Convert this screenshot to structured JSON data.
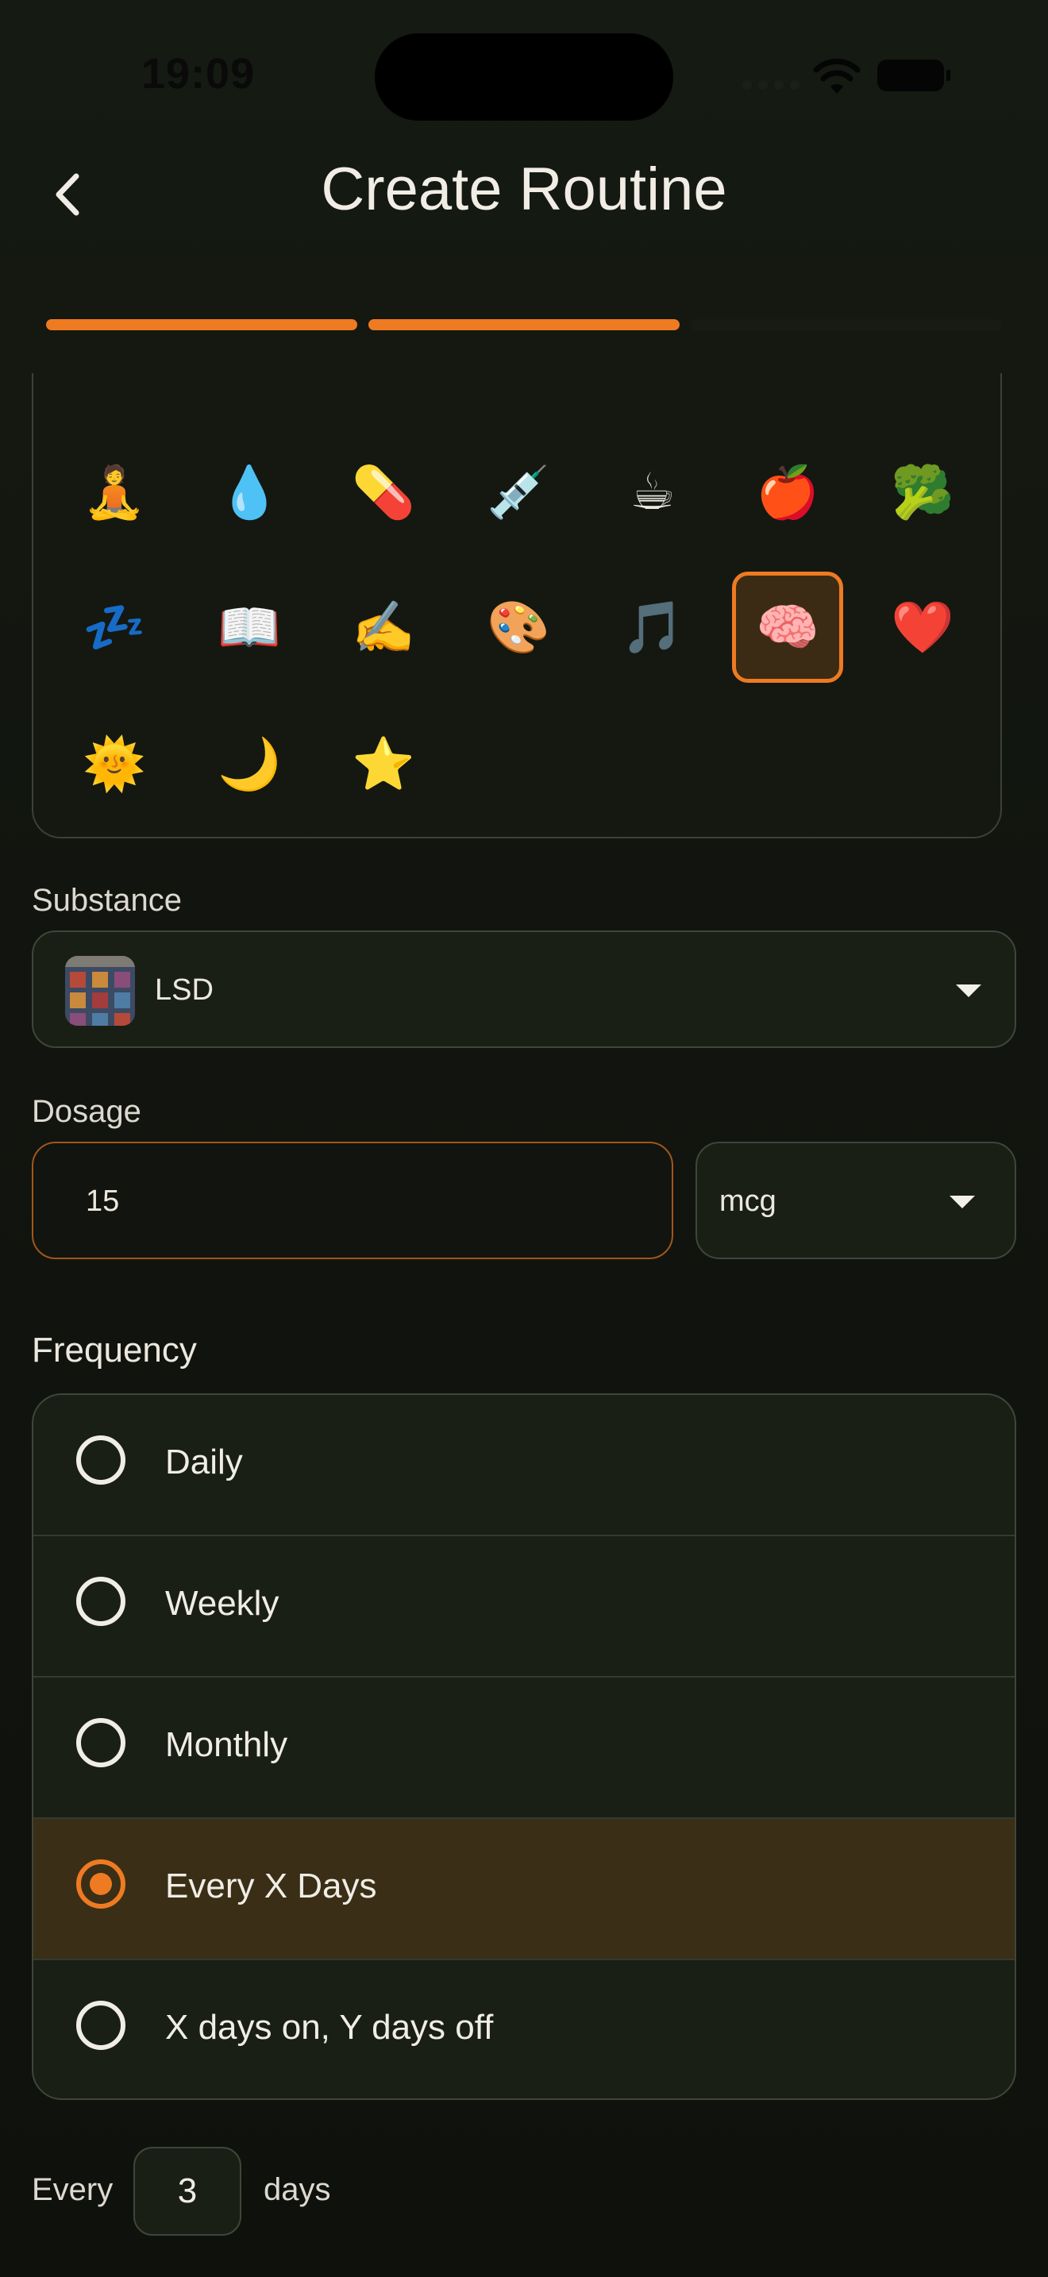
{
  "status_bar": {
    "time": "19:09"
  },
  "header": {
    "title": "Create Routine"
  },
  "progress": {
    "total_steps": 3,
    "completed_steps": 2,
    "accent": "#ee7a22"
  },
  "icon_picker": {
    "icons": [
      "🧘",
      "💧",
      "💊",
      "💉",
      "☕",
      "🍎",
      "🥦",
      "💤",
      "📖",
      "✍️",
      "🎨",
      "🎵",
      "🧠",
      "❤️",
      "🌞",
      "🌙",
      "⭐"
    ],
    "selected": "🧠"
  },
  "substance": {
    "label": "Substance",
    "value": "LSD"
  },
  "dosage": {
    "label": "Dosage",
    "amount": "15",
    "unit": "mcg"
  },
  "frequency": {
    "label": "Frequency",
    "options": [
      "Daily",
      "Weekly",
      "Monthly",
      "Every X Days",
      "X days on, Y days off"
    ],
    "selected": "Every X Days"
  },
  "interval": {
    "prefix": "Every",
    "value": "3",
    "suffix": "days"
  }
}
